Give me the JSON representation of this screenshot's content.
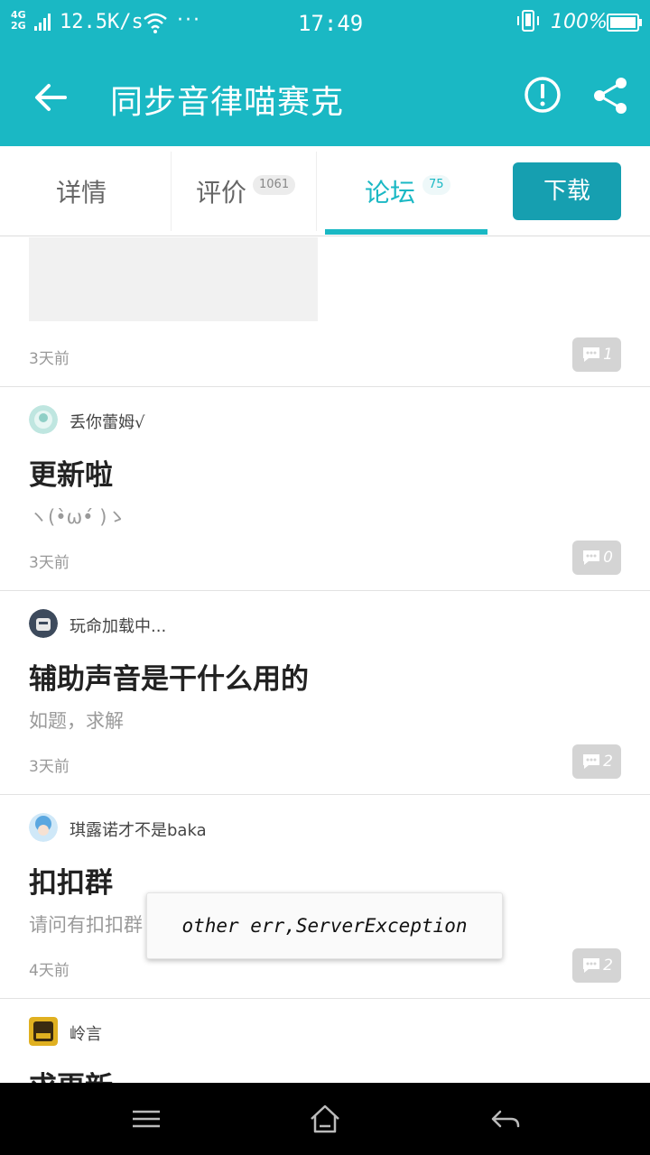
{
  "status_bar": {
    "network": "4G\n2G",
    "speed": "12.5K/s",
    "more": "···",
    "time": "17:49",
    "battery_percent": "100%"
  },
  "app_bar": {
    "title": "同步音律喵赛克",
    "back_icon": "arrow-left-icon",
    "report_icon": "exclamation-circle-icon",
    "share_icon": "share-icon"
  },
  "tabs": [
    {
      "label": "详情",
      "badge": ""
    },
    {
      "label": "评价",
      "badge": "1061"
    },
    {
      "label": "论坛",
      "badge": "75",
      "active": true
    }
  ],
  "download_label": "下载",
  "posts": [
    {
      "time": "3天前",
      "comments": "1"
    },
    {
      "author": "丢你蕾姆√",
      "title": "更新啦",
      "body": "ヽ(•̀ω•́ )ゝ",
      "time": "3天前",
      "comments": "0"
    },
    {
      "author": "玩命加载中...",
      "title": "辅助声音是干什么用的",
      "body": "如题，求解",
      "time": "3天前",
      "comments": "2"
    },
    {
      "author": "琪露诺才不是baka",
      "title": "扣扣群",
      "body": "请问有扣扣群",
      "time": "4天前",
      "comments": "2"
    },
    {
      "author": "岭言",
      "title": "求更新"
    }
  ],
  "toast": "other err,ServerException",
  "colors": {
    "accent": "#1ab8c4",
    "download_button": "#169fb0",
    "comment_badge": "#d4d4d4"
  }
}
